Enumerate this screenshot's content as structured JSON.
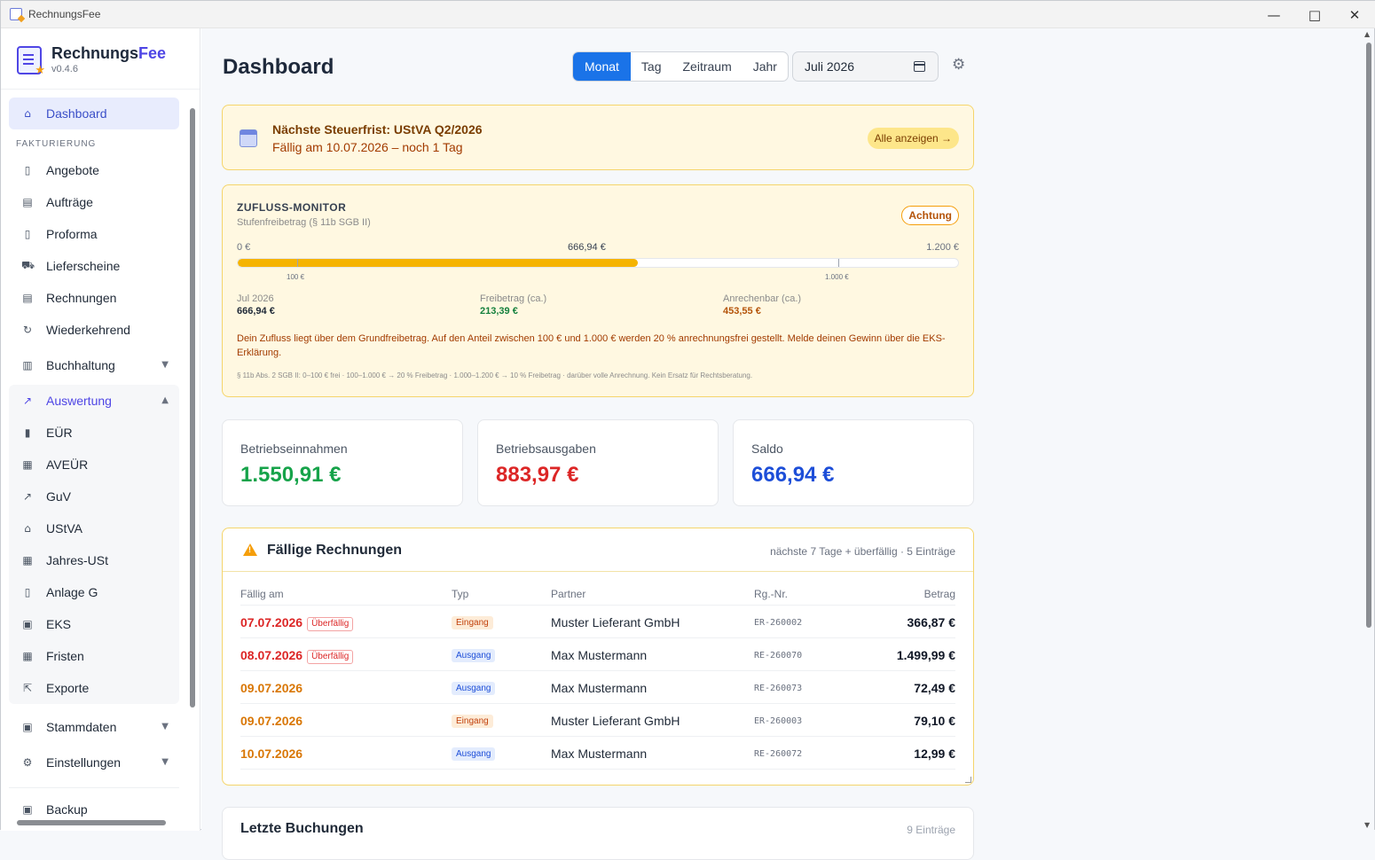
{
  "window": {
    "title": "RechnungsFee"
  },
  "brand": {
    "name_a": "Rechnungs",
    "name_b": "Fee",
    "version": "v0.4.6"
  },
  "sidebar": {
    "dashboard": "Dashboard",
    "section_fakturierung": "FAKTURIERUNG",
    "items_fakturierung": [
      "Angebote",
      "Aufträge",
      "Proforma",
      "Lieferscheine",
      "Rechnungen",
      "Wiederkehrend"
    ],
    "buchhaltung": "Buchhaltung",
    "auswertung": "Auswertung",
    "items_auswertung": [
      "EÜR",
      "AVEÜR",
      "GuV",
      "UStVA",
      "Jahres-USt",
      "Anlage G",
      "EKS",
      "Fristen",
      "Exporte"
    ],
    "stammdaten": "Stammdaten",
    "einstellungen": "Einstellungen",
    "backup": "Backup"
  },
  "header": {
    "title": "Dashboard",
    "periods": [
      "Monat",
      "Tag",
      "Zeitraum",
      "Jahr"
    ],
    "active_period": "Monat",
    "date_value": "Juli 2026"
  },
  "alert": {
    "title": "Nächste Steuerfrist: UStVA Q2/2026",
    "subtitle": "Fällig am 10.07.2026 – noch 1 Tag",
    "button": "Alle anzeigen →"
  },
  "monitor": {
    "title": "ZUFLUSS-MONITOR",
    "subtitle": "Stufenfreibetrag (§ 11b SGB II)",
    "badge": "Achtung",
    "min_label": "0 €",
    "current_label": "666,94 €",
    "max_label": "1.200 €",
    "tick_100": "100 €",
    "tick_1000": "1.000 €",
    "fill_fraction": 0.5558,
    "stat_month_label": "Jul 2026",
    "stat_month_value": "666,94 €",
    "stat_free_label": "Freibetrag (ca.)",
    "stat_free_value": "213,39 €",
    "stat_anr_label": "Anrechenbar (ca.)",
    "stat_anr_value": "453,55 €",
    "message": "Dein Zufluss liegt über dem Grundfreibetrag. Auf den Anteil zwischen 100 € und 1.000 € werden 20 % anrechnungsfrei gestellt. Melde deinen Gewinn über die EKS-Erklärung.",
    "footnote": "§ 11b Abs. 2 SGB II: 0–100 € frei · 100–1.000 € → 20 % Freibetrag · 1.000–1.200 € → 10 % Freibetrag · darüber volle Anrechnung. Kein Ersatz für Rechtsberatung."
  },
  "cards": [
    {
      "label": "Betriebseinnahmen",
      "value": "1.550,91 €",
      "color": "#16a34a"
    },
    {
      "label": "Betriebsausgaben",
      "value": "883,97 €",
      "color": "#dc2626"
    },
    {
      "label": "Saldo",
      "value": "666,94 €",
      "color": "#1d4ed8"
    }
  ],
  "due": {
    "title": "Fällige Rechnungen",
    "summary": "nächste 7 Tage + überfällig · 5 Einträge",
    "columns": [
      "Fällig am",
      "Typ",
      "Partner",
      "Rg.-Nr.",
      "Betrag"
    ],
    "overdue_label": "Überfällig",
    "rows": [
      {
        "date": "07.07.2026",
        "overdue": true,
        "type": "Eingang",
        "partner": "Muster Lieferant GmbH",
        "nr": "ER-260002",
        "amount": "366,87 €"
      },
      {
        "date": "08.07.2026",
        "overdue": true,
        "type": "Ausgang",
        "partner": "Max Mustermann",
        "nr": "RE-260070",
        "amount": "1.499,99 €"
      },
      {
        "date": "09.07.2026",
        "overdue": false,
        "type": "Ausgang",
        "partner": "Max Mustermann",
        "nr": "RE-260073",
        "amount": "72,49 €"
      },
      {
        "date": "09.07.2026",
        "overdue": false,
        "type": "Eingang",
        "partner": "Muster Lieferant GmbH",
        "nr": "ER-260003",
        "amount": "79,10 €"
      },
      {
        "date": "10.07.2026",
        "overdue": false,
        "type": "Ausgang",
        "partner": "Max Mustermann",
        "nr": "RE-260072",
        "amount": "12,99 €"
      }
    ]
  },
  "last": {
    "title": "Letzte Buchungen",
    "summary": "9 Einträge"
  },
  "colors": {
    "accent": "#1a73e8",
    "overdue": "#dc2626",
    "upcoming": "#d97706",
    "warning_bg": "#fff8e1"
  }
}
